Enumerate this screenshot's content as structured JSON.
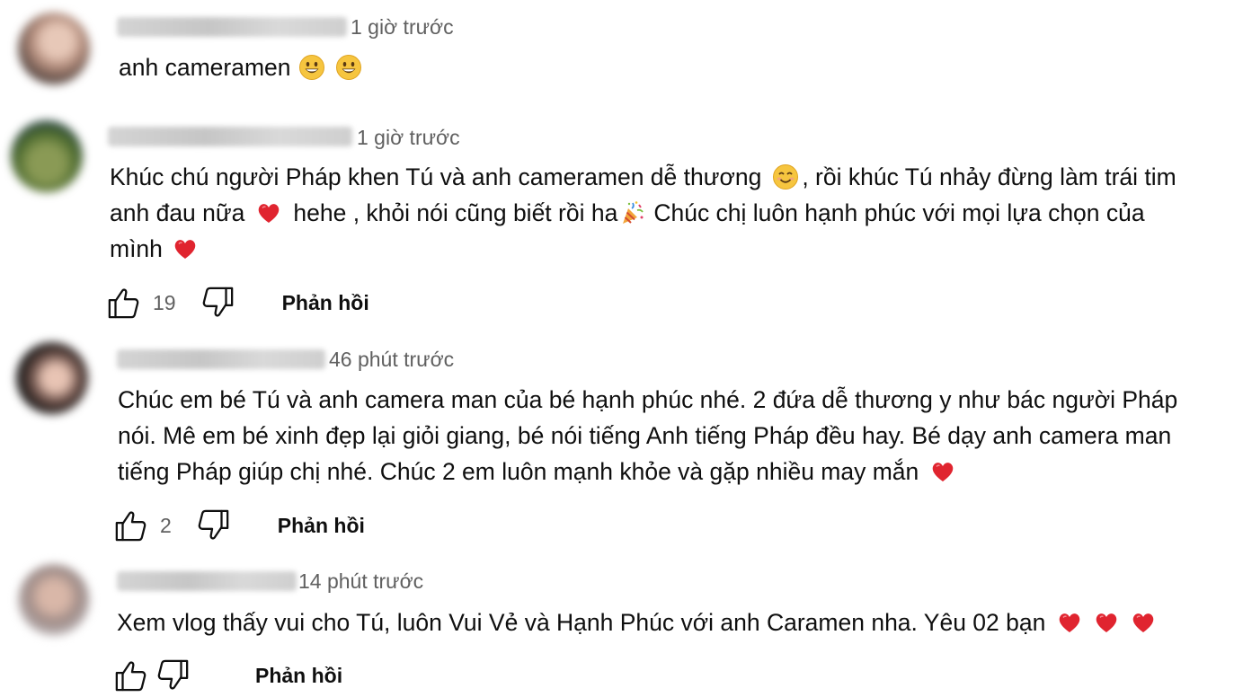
{
  "comments": [
    {
      "time": "1 giờ trước",
      "lines": [
        "anh cameramen"
      ],
      "emoji_tail": [
        "grinning-face",
        "grinning-face"
      ]
    },
    {
      "time": "1 giờ trước",
      "text_parts": {
        "l1a": "Khúc chú người Pháp khen Tú và anh cameramen dễ thương",
        "l1b": ", rồi khúc Tú nhảy đừng làm trái tim",
        "l2a": "anh đau nữa",
        "l2b": "hehe  , khỏi nói cũng biết rồi ha",
        "l2c": "Chúc chị luôn hạnh phúc với mọi lựa chọn của",
        "l3a": "mình"
      },
      "likes": "19",
      "reply_label": "Phản hồi"
    },
    {
      "time": "46 phút trước",
      "text_parts": {
        "l1": "Chúc em bé Tú và anh camera man của bé hạnh phúc nhé. 2 đứa dễ thương y như bác người Pháp",
        "l2": "nói. Mê em bé xinh đẹp lại giỏi giang, bé nói tiếng Anh tiếng Pháp đều hay. Bé dạy anh camera man",
        "l3": "tiếng Pháp giúp chị nhé. Chúc 2 em luôn mạnh khỏe và gặp nhiều may mắn"
      },
      "likes": "2",
      "reply_label": "Phản hồi"
    },
    {
      "time": "14 phút trước",
      "text_parts": {
        "l1": "Xem vlog thấy vui cho Tú, luôn Vui Vẻ và Hạnh Phúc với anh Caramen nha. Yêu 02 bạn"
      },
      "likes": "",
      "reply_label": "Phản hồi"
    }
  ],
  "colors": {
    "text": "#0f0f0f",
    "meta": "#606060",
    "heart": "#e0242f",
    "emoji_face": "#f6c53f"
  }
}
